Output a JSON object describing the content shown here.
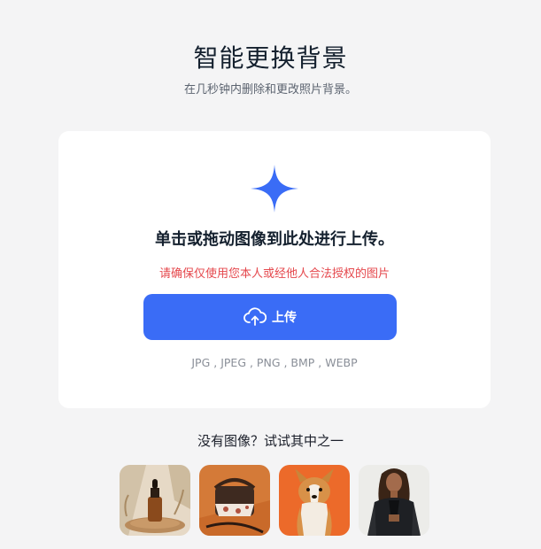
{
  "header": {
    "title": "智能更换背景",
    "subtitle": "在几秒钟内删除和更改照片背景。"
  },
  "upload_card": {
    "icon": "sparkle-icon",
    "drop_text": "单击或拖动图像到此处进行上传。",
    "warning": "请确保仅使用您本人或经他人合法授权的图片",
    "button_label": "上传",
    "button_icon": "cloud-upload-icon",
    "formats": "JPG , JPEG , PNG , BMP , WEBP"
  },
  "samples": {
    "label": "没有图像？试试其中之一",
    "items": [
      {
        "name": "dropper-bottle"
      },
      {
        "name": "leather-bag"
      },
      {
        "name": "corgi-dog"
      },
      {
        "name": "woman-in-jacket"
      }
    ]
  },
  "colors": {
    "accent": "#3a6cf6",
    "warning": "#e5484d",
    "background": "#f4f4f5"
  }
}
